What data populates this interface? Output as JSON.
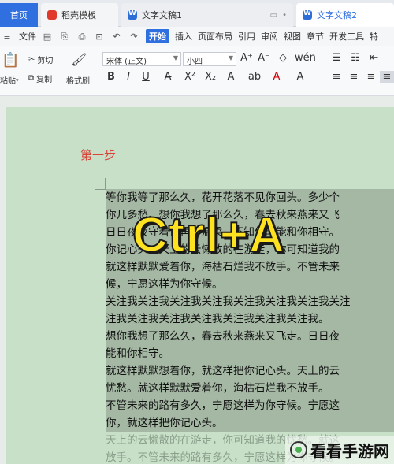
{
  "tabs": {
    "home": "首页",
    "templates": "稻壳模板",
    "doc1": "文字文稿1",
    "doc2": "文字文稿2"
  },
  "menu": {
    "file": "文件",
    "start": "开始",
    "insert": "插入",
    "layout": "页面布局",
    "reference": "引用",
    "review": "审阅",
    "view": "视图",
    "chapter": "章节",
    "devtools": "开发工具",
    "more": "特"
  },
  "toolbar": {
    "paste": "粘贴",
    "cut": "剪切",
    "copy": "复制",
    "format_painter": "格式刷",
    "font_name": "宋体 (正文)",
    "font_size": "小四"
  },
  "document": {
    "step_label": "第一步",
    "lines": [
      "等你我等了那么久，花开花落不见你回头。多少个",
      "你几多愁。想你我想了那么久，春去秋来燕来又飞",
      "日日夜夜守着你再份温柔。不知何时能和你相守。",
      "你记心头。天上的云懒散的在游走，你可知道我的",
      "就这样默默爱着你，海枯石烂我不放手。不管未来",
      "候，宁愿这样为你守候。",
      "关注我关注我关注我关注我关注我关注我关注我关注",
      "注我关注我关注我关注我关注我关注我关注我。",
      "想你我想了那么久，春去秋来燕来又飞走。日日夜",
      "能和你相守。",
      "就这样默默想着你，就这样把你记心头。天上的云",
      "忧愁。就这样默默爱着你，海枯石烂我不放手。",
      "不管未来的路有多久，宁愿这样为你守候。宁愿这",
      "你，就这样把你记心头。",
      "天上的云懒散的在游走，你可知道我的忧愁。就这",
      "放手。不管未来的路有多久，宁愿这样为你守候。"
    ],
    "overlay_text": "Ctrl+A"
  },
  "watermark": "看看手游网"
}
